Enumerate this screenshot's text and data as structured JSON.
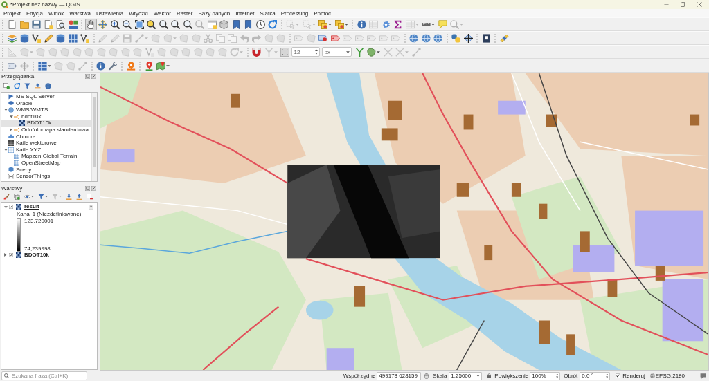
{
  "window": {
    "title": "*Projekt bez nazwy — QGIS"
  },
  "menu": [
    "Projekt",
    "Edycja",
    "Widok",
    "Warstwa",
    "Ustawienia",
    "Wtyczki",
    "Wektor",
    "Raster",
    "Bazy danych",
    "Internet",
    "Siatka",
    "Processing",
    "Pomoc"
  ],
  "toolbars": [
    [
      {
        "kind": "page",
        "disabled": false,
        "pressed": false
      },
      {
        "kind": "folder",
        "disabled": false,
        "pressed": false
      },
      {
        "kind": "floppy",
        "disabled": false,
        "pressed": false
      },
      {
        "kind": "document",
        "disabled": false,
        "pressed": false
      },
      {
        "kind": "preview",
        "disabled": false,
        "pressed": false
      },
      {
        "kind": "shapes",
        "disabled": false,
        "pressed": false
      },
      {
        "kind": "separator"
      },
      {
        "kind": "hand",
        "disabled": false,
        "pressed": true
      },
      {
        "kind": "move",
        "disabled": false,
        "pressed": false
      },
      {
        "kind": "zoomin",
        "disabled": false,
        "pressed": false
      },
      {
        "kind": "zoomout",
        "disabled": false,
        "pressed": false
      },
      {
        "kind": "expand",
        "disabled": false,
        "pressed": false
      },
      {
        "kind": "zoomsel",
        "disabled": false,
        "pressed": false
      },
      {
        "kind": "magnifier",
        "disabled": false,
        "pressed": false
      },
      {
        "kind": "magnifier",
        "disabled": false,
        "pressed": false
      },
      {
        "kind": "magnifier",
        "disabled": false,
        "pressed": false
      },
      {
        "kind": "magnifier",
        "disabled": true,
        "pressed": false
      },
      {
        "kind": "window",
        "disabled": false,
        "pressed": false
      },
      {
        "kind": "cube",
        "disabled": false,
        "pressed": false
      },
      {
        "kind": "bookmark",
        "disabled": false,
        "pressed": false
      },
      {
        "kind": "bookmark",
        "disabled": false,
        "pressed": false
      },
      {
        "kind": "clock",
        "disabled": false,
        "pressed": false
      },
      {
        "kind": "refresh",
        "disabled": false,
        "pressed": false
      },
      {
        "kind": "separator"
      },
      {
        "kind": "selection",
        "disabled": true,
        "pressed": false,
        "menu": true
      },
      {
        "kind": "selection",
        "disabled": true,
        "pressed": false,
        "menu": true
      },
      {
        "kind": "squares",
        "disabled": false,
        "pressed": false,
        "menu": true
      },
      {
        "kind": "squares",
        "disabled": false,
        "pressed": false,
        "menu": true
      },
      {
        "kind": "separator"
      },
      {
        "kind": "info",
        "disabled": false,
        "pressed": false
      },
      {
        "kind": "table",
        "disabled": true,
        "pressed": false
      },
      {
        "kind": "gear",
        "disabled": false,
        "pressed": false
      },
      {
        "kind": "sigma",
        "disabled": false,
        "pressed": false
      },
      {
        "kind": "table",
        "disabled": true,
        "pressed": false,
        "menu": true
      },
      {
        "kind": "ruler",
        "disabled": false,
        "pressed": false,
        "menu": true
      },
      {
        "kind": "bubble",
        "disabled": false,
        "pressed": false
      },
      {
        "kind": "search",
        "disabled": true,
        "pressed": false,
        "menu": true
      }
    ],
    [
      {
        "kind": "layers",
        "disabled": false,
        "pressed": false
      },
      {
        "kind": "database",
        "disabled": false,
        "pressed": false
      },
      {
        "kind": "polyline",
        "disabled": false,
        "pressed": false
      },
      {
        "kind": "pencil",
        "disabled": false,
        "pressed": false
      },
      {
        "kind": "database",
        "disabled": false,
        "pressed": false
      },
      {
        "kind": "grid",
        "disabled": false,
        "pressed": false
      },
      {
        "kind": "polyline",
        "disabled": false,
        "pressed": false
      },
      {
        "kind": "separator"
      },
      {
        "kind": "pencil",
        "disabled": true,
        "pressed": false
      },
      {
        "kind": "pencil",
        "disabled": true,
        "pressed": false
      },
      {
        "kind": "floppy",
        "disabled": true,
        "pressed": false
      },
      {
        "kind": "line",
        "disabled": true,
        "pressed": false,
        "menu": true
      },
      {
        "kind": "polygon",
        "disabled": true,
        "pressed": false
      },
      {
        "kind": "polygon",
        "disabled": true,
        "pressed": false,
        "menu": true
      },
      {
        "kind": "polygon",
        "disabled": true,
        "pressed": false
      },
      {
        "kind": "polygon",
        "disabled": true,
        "pressed": false
      },
      {
        "kind": "scissors",
        "disabled": true,
        "pressed": false
      },
      {
        "kind": "copy",
        "disabled": true,
        "pressed": false
      },
      {
        "kind": "copy",
        "disabled": true,
        "pressed": false
      },
      {
        "kind": "undo",
        "disabled": true,
        "pressed": false
      },
      {
        "kind": "redo",
        "disabled": true,
        "pressed": false
      },
      {
        "kind": "polygon",
        "disabled": true,
        "pressed": false
      },
      {
        "kind": "polygon",
        "disabled": true,
        "pressed": false
      },
      {
        "kind": "separator"
      },
      {
        "kind": "tag",
        "disabled": true,
        "pressed": false
      },
      {
        "kind": "polygon",
        "disabled": true,
        "pressed": false
      },
      {
        "kind": "tagdot",
        "disabled": false,
        "pressed": false
      },
      {
        "kind": "tagred",
        "disabled": false,
        "pressed": false
      },
      {
        "kind": "tag",
        "disabled": true,
        "pressed": false
      },
      {
        "kind": "tag",
        "disabled": true,
        "pressed": false
      },
      {
        "kind": "tag",
        "disabled": true,
        "pressed": false
      },
      {
        "kind": "tag",
        "disabled": true,
        "pressed": false
      },
      {
        "kind": "tag",
        "disabled": true,
        "pressed": false
      },
      {
        "kind": "separator"
      },
      {
        "kind": "globe",
        "disabled": false,
        "pressed": false
      },
      {
        "kind": "globe",
        "disabled": false,
        "pressed": false
      },
      {
        "kind": "globe",
        "disabled": false,
        "pressed": false
      },
      {
        "kind": "separator"
      },
      {
        "kind": "snake",
        "disabled": false,
        "pressed": false
      },
      {
        "kind": "crosshair",
        "disabled": false,
        "pressed": false
      },
      {
        "kind": "separator"
      },
      {
        "kind": "book",
        "disabled": false,
        "pressed": false
      },
      {
        "kind": "separator"
      },
      {
        "kind": "satellite",
        "disabled": false,
        "pressed": false
      }
    ],
    [
      {
        "kind": "triangle",
        "disabled": true,
        "pressed": false
      },
      {
        "kind": "polygon",
        "disabled": true,
        "pressed": false,
        "menu": true
      },
      {
        "kind": "polygon",
        "disabled": true,
        "pressed": false
      },
      {
        "kind": "polygon",
        "disabled": true,
        "pressed": false
      },
      {
        "kind": "polygon",
        "disabled": true,
        "pressed": false
      },
      {
        "kind": "polygon",
        "disabled": true,
        "pressed": false
      },
      {
        "kind": "polygon",
        "disabled": true,
        "pressed": false
      },
      {
        "kind": "polygon",
        "disabled": true,
        "pressed": false
      },
      {
        "kind": "polygon",
        "disabled": true,
        "pressed": false
      },
      {
        "kind": "polygon",
        "disabled": true,
        "pressed": false
      },
      {
        "kind": "polygon",
        "disabled": true,
        "pressed": false
      },
      {
        "kind": "polyline",
        "disabled": true,
        "pressed": false
      },
      {
        "kind": "polygon",
        "disabled": true,
        "pressed": false
      },
      {
        "kind": "polygon",
        "disabled": true,
        "pressed": false
      },
      {
        "kind": "polygon",
        "disabled": true,
        "pressed": false
      },
      {
        "kind": "polygon",
        "disabled": true,
        "pressed": false
      },
      {
        "kind": "polygon",
        "disabled": true,
        "pressed": false
      },
      {
        "kind": "polygon",
        "disabled": true,
        "pressed": false
      },
      {
        "kind": "refresh",
        "disabled": true,
        "pressed": false,
        "menu": true
      },
      {
        "kind": "separator"
      },
      {
        "kind": "magnet",
        "disabled": false,
        "pressed": false
      },
      {
        "kind": "fork",
        "disabled": true,
        "pressed": false,
        "menu": true
      },
      {
        "kind": "dots",
        "disabled": false,
        "pressed": false
      },
      {
        "kind": "spin",
        "value": "12"
      },
      {
        "kind": "combo",
        "value": "px"
      },
      {
        "kind": "fork",
        "disabled": false,
        "pressed": false
      },
      {
        "kind": "blob",
        "disabled": false,
        "pressed": false,
        "menu": true
      },
      {
        "kind": "cross",
        "disabled": true,
        "pressed": false
      },
      {
        "kind": "cross",
        "disabled": true,
        "pressed": false,
        "menu": true
      },
      {
        "kind": "line",
        "disabled": true,
        "pressed": false
      }
    ],
    [
      {
        "kind": "tag",
        "disabled": false,
        "pressed": false
      },
      {
        "kind": "crosshair",
        "disabled": true,
        "pressed": false
      },
      {
        "kind": "separator"
      },
      {
        "kind": "grid",
        "disabled": false,
        "pressed": false,
        "menu": true
      },
      {
        "kind": "polygon",
        "disabled": true,
        "pressed": false
      },
      {
        "kind": "polygon",
        "disabled": true,
        "pressed": false
      },
      {
        "kind": "line",
        "disabled": true,
        "pressed": false
      },
      {
        "kind": "separator"
      },
      {
        "kind": "info",
        "disabled": false,
        "pressed": false
      },
      {
        "kind": "wrench",
        "disabled": false,
        "pressed": false
      },
      {
        "kind": "separator"
      },
      {
        "kind": "marker",
        "disabled": false,
        "pressed": false
      },
      {
        "kind": "separator"
      },
      {
        "kind": "pin",
        "disabled": false,
        "pressed": false
      },
      {
        "kind": "map",
        "disabled": false,
        "pressed": false,
        "menu": true
      }
    ]
  ],
  "browser": {
    "title": "Przeglądarka",
    "tools": [
      {
        "kind": "add",
        "disabled": false
      },
      {
        "kind": "refresh",
        "disabled": false
      },
      {
        "kind": "filter",
        "disabled": false
      },
      {
        "kind": "collapse",
        "disabled": false
      },
      {
        "kind": "info",
        "disabled": false
      }
    ],
    "items": [
      {
        "label": "MS SQL Server",
        "kind": "mssql",
        "selected": false
      },
      {
        "label": "Oracle",
        "kind": "oracle",
        "selected": false
      },
      {
        "label": "WMS/WMTS",
        "kind": "globe",
        "selected": false,
        "expanded": true,
        "children": [
          {
            "label": "bdot10k",
            "kind": "connection",
            "selected": false,
            "expanded": true,
            "children": [
              {
                "label": "BDOT10k",
                "kind": "raster",
                "selected": true
              }
            ]
          },
          {
            "label": "Ortofotomapa standardowa",
            "kind": "connection",
            "selected": false,
            "expanded": false
          }
        ]
      },
      {
        "label": "Chmura",
        "kind": "cloud",
        "selected": false
      },
      {
        "label": "Kafle wektorowe",
        "kind": "tiles",
        "selected": false
      },
      {
        "label": "Kafle XYZ",
        "kind": "xyz",
        "selected": false,
        "expanded": true,
        "children": [
          {
            "label": "Mapzen Global Terrain",
            "kind": "xyz",
            "selected": false
          },
          {
            "label": "OpenStreetMap",
            "kind": "xyz",
            "selected": false
          }
        ]
      },
      {
        "label": "Sceny",
        "kind": "scenes",
        "selected": false
      },
      {
        "label": "SensorThings",
        "kind": "sensor",
        "selected": false
      }
    ]
  },
  "layers": {
    "title": "Warstwy",
    "tools": [
      {
        "kind": "brush",
        "disabled": false
      },
      {
        "kind": "group",
        "disabled": false
      },
      {
        "kind": "eye",
        "disabled": false,
        "menu": true
      },
      {
        "kind": "filter",
        "disabled": false,
        "menu": true
      },
      {
        "kind": "filter",
        "disabled": true,
        "menu": true
      },
      {
        "kind": "expandall",
        "disabled": false
      },
      {
        "kind": "collapse",
        "disabled": false
      },
      {
        "kind": "remove",
        "disabled": false
      }
    ],
    "items": [
      {
        "name": "result",
        "kind": "raster",
        "checked": true,
        "expanded": true,
        "current": true,
        "flagged": true,
        "legend": {
          "band": "Kanał 1 (Niezdefiniowane)",
          "max": "123,720001",
          "min": "74,239998"
        }
      },
      {
        "name": "BDOT10k",
        "kind": "raster",
        "checked": true,
        "expanded": false,
        "current": false,
        "flagged": false
      }
    ]
  },
  "locator": {
    "placeholder": "Szukana fraza (Ctrl+K)"
  },
  "status_bar": {
    "coordinate_label": "Współrzędne",
    "coordinate": "499178 628159",
    "scale_label": "Skala",
    "scale": "1:25000",
    "magnifier_label": "Powiększenie",
    "magnifier": "100%",
    "rotation_label": "Obrót",
    "rotation": "0,0 °",
    "render_label": "Renderuj",
    "render": true,
    "crs": "EPSG:2180"
  }
}
